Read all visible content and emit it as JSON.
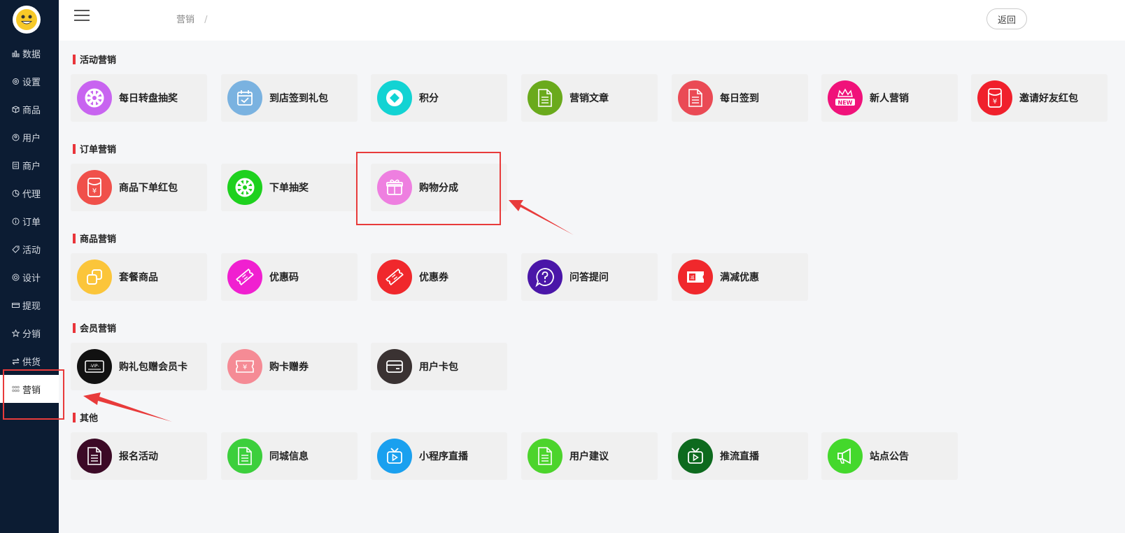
{
  "sidebar": {
    "items": [
      {
        "label": "数据",
        "icon": "bar-chart-icon"
      },
      {
        "label": "设置",
        "icon": "gear-icon"
      },
      {
        "label": "商品",
        "icon": "box-icon"
      },
      {
        "label": "用户",
        "icon": "user-icon"
      },
      {
        "label": "商户",
        "icon": "store-icon"
      },
      {
        "label": "代理",
        "icon": "pie-icon"
      },
      {
        "label": "订单",
        "icon": "info-icon"
      },
      {
        "label": "活动",
        "icon": "tag-icon"
      },
      {
        "label": "设计",
        "icon": "palette-icon"
      },
      {
        "label": "提现",
        "icon": "card-icon"
      },
      {
        "label": "分销",
        "icon": "star-icon"
      },
      {
        "label": "供货",
        "icon": "swap-icon"
      },
      {
        "label": "营销",
        "icon": "grid-icon",
        "active": true
      }
    ]
  },
  "header": {
    "breadcrumb": "营销",
    "breadcrumb_sep": "/",
    "back_label": "返回"
  },
  "sections": [
    {
      "title": "活动营销",
      "items": [
        {
          "label": "每日转盘抽奖",
          "icon": "wheel-icon",
          "color": "#c864f0"
        },
        {
          "label": "到店签到礼包",
          "icon": "calendar-check-icon",
          "color": "#7ab2e0"
        },
        {
          "label": "积分",
          "icon": "diamond-icon",
          "color": "#12d3d3"
        },
        {
          "label": "营销文章",
          "icon": "document-icon",
          "color": "#6aaa1c"
        },
        {
          "label": "每日签到",
          "icon": "document-icon",
          "color": "#ea4a55"
        },
        {
          "label": "新人营销",
          "icon": "new-crown-icon",
          "color": "#f0127a"
        },
        {
          "label": "邀请好友红包",
          "icon": "red-packet-icon",
          "color": "#f0202c"
        }
      ]
    },
    {
      "title": "订单营销",
      "items": [
        {
          "label": "商品下单红包",
          "icon": "red-packet-icon",
          "color": "#f0504a"
        },
        {
          "label": "下单抽奖",
          "icon": "wheel-icon",
          "color": "#1ed11e"
        },
        {
          "label": "购物分成",
          "icon": "gift-icon",
          "color": "#ee7fe0"
        }
      ]
    },
    {
      "title": "商品营销",
      "items": [
        {
          "label": "套餐商品",
          "icon": "copy-icon",
          "color": "#fbc53a"
        },
        {
          "label": "优惠码",
          "icon": "ticket-icon",
          "color": "#f020d0"
        },
        {
          "label": "优惠券",
          "icon": "ticket-icon",
          "color": "#f0282c"
        },
        {
          "label": "问答提问",
          "icon": "question-icon",
          "color": "#4a16a8"
        },
        {
          "label": "满减优惠",
          "icon": "discount-coupon-icon",
          "color": "#f0282c"
        }
      ]
    },
    {
      "title": "会员营销",
      "items": [
        {
          "label": "购礼包赠会员卡",
          "icon": "vip-card-icon",
          "color": "#111111"
        },
        {
          "label": "购卡赠券",
          "icon": "yuan-coupon-icon",
          "color": "#f58b95"
        },
        {
          "label": "用户卡包",
          "icon": "wallet-icon",
          "color": "#3a3232"
        }
      ]
    },
    {
      "title": "其他",
      "items": [
        {
          "label": "报名活动",
          "icon": "document-icon",
          "color": "#3c0a26"
        },
        {
          "label": "同城信息",
          "icon": "document-icon",
          "color": "#3ccf3c"
        },
        {
          "label": "小程序直播",
          "icon": "tv-play-icon",
          "color": "#1aa0ef"
        },
        {
          "label": "用户建议",
          "icon": "document-icon",
          "color": "#4cd42c"
        },
        {
          "label": "推流直播",
          "icon": "tv-play-icon",
          "color": "#0d6a1e"
        },
        {
          "label": "站点公告",
          "icon": "megaphone-icon",
          "color": "#44d82c"
        }
      ]
    }
  ]
}
